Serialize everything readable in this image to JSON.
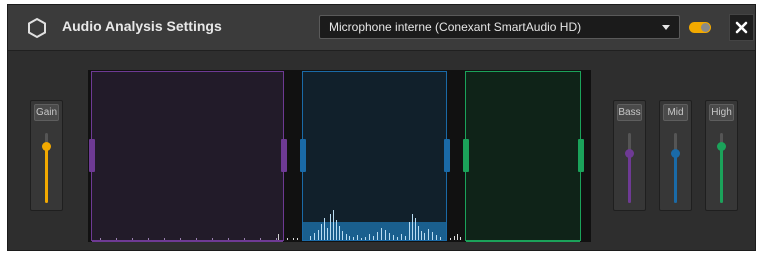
{
  "header": {
    "title": "Audio Analysis Settings",
    "device": "Microphone interne (Conexant SmartAudio HD)",
    "close_label": "✕"
  },
  "icons": {
    "logo": "hexagon-icon",
    "dropdown": "chevron-down-icon",
    "close": "close-icon"
  },
  "toggle": {
    "on": true,
    "color": "#f2a900"
  },
  "gain": {
    "label": "Gain",
    "level": 0.82,
    "color": "#f2a900"
  },
  "bands": [
    {
      "id": "bass",
      "label": "Bass",
      "level": 0.72,
      "color": "#6e3a94"
    },
    {
      "id": "mid",
      "label": "Mid",
      "level": 0.72,
      "color": "#1a6aa7"
    },
    {
      "id": "high",
      "label": "High",
      "level": 0.82,
      "color": "#1ba25a"
    }
  ]
}
